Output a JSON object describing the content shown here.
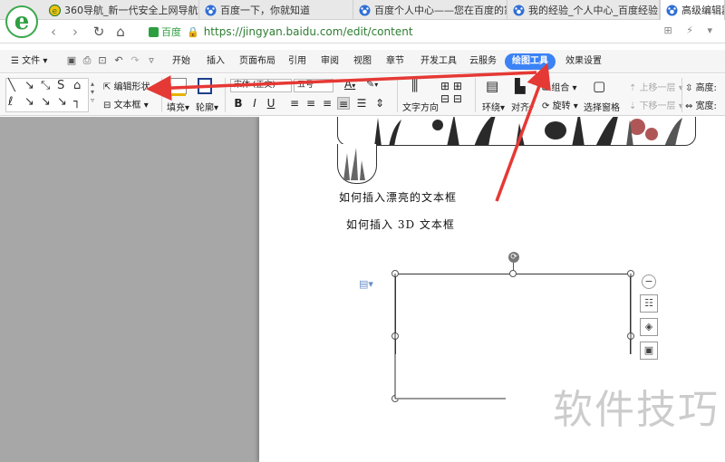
{
  "browser": {
    "tabs": [
      {
        "label": "360导航_新一代安全上网导航",
        "icon": "360-icon"
      },
      {
        "label": "百度一下，你就知道",
        "icon": "baidu-paw-icon"
      },
      {
        "label": "百度个人中心——您在百度的家",
        "icon": "baidu-paw-icon"
      },
      {
        "label": "我的经验_个人中心_百度经验",
        "icon": "baidu-paw-icon"
      },
      {
        "label": "高级编辑器_百",
        "icon": "baidu-paw-icon"
      }
    ],
    "address": {
      "badge": "百度",
      "url": "https://jingyan.baidu.com/edit/content"
    }
  },
  "menu": {
    "file": "文件",
    "items": [
      "开始",
      "插入",
      "页面布局",
      "引用",
      "审阅",
      "视图",
      "章节",
      "开发工具",
      "云服务",
      "绘图工具",
      "效果设置"
    ],
    "active": "绘图工具"
  },
  "ribbon": {
    "edit_shape": "编辑形状",
    "text_box": "文本框",
    "fill": "填充",
    "outline": "轮廓",
    "font": "宋体 (正文)",
    "size": "五号",
    "text_direction": "文字方向",
    "wrap": "环绕",
    "align": "对齐",
    "group": "组合",
    "rotate": "旋转",
    "selection_pane": "选择窗格",
    "bring_forward": "上移一层",
    "send_backward": "下移一层",
    "height": "高度:",
    "width": "宽度:"
  },
  "document": {
    "line1": "如何插入漂亮的文本框",
    "line2": "如何插入 3D 文本框"
  },
  "watermark": "软件技巧",
  "colors": {
    "accent": "#3b82f6",
    "arrow": "#e53935",
    "browser_green": "#2e9f40"
  }
}
